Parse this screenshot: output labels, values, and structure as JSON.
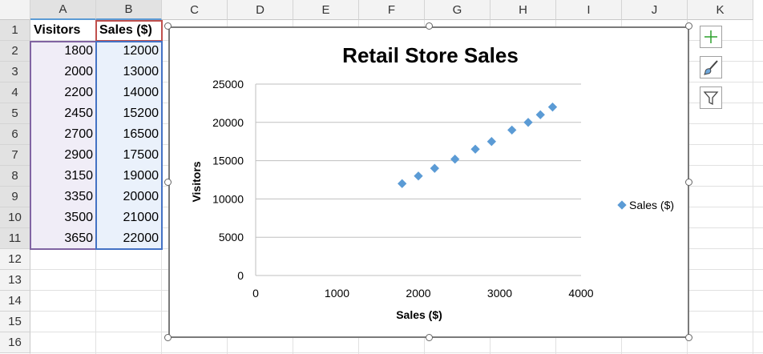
{
  "spreadsheet": {
    "columns": [
      "A",
      "B",
      "C",
      "D",
      "E",
      "F",
      "G",
      "H",
      "I",
      "J",
      "K"
    ],
    "rows": [
      "1",
      "2",
      "3",
      "4",
      "5",
      "6",
      "7",
      "8",
      "9",
      "10",
      "11",
      "12",
      "13",
      "14",
      "15",
      "16"
    ],
    "header": [
      "Visitors",
      "Sales ($)"
    ],
    "data": [
      [
        "1800",
        "12000"
      ],
      [
        "2000",
        "13000"
      ],
      [
        "2200",
        "14000"
      ],
      [
        "2450",
        "15200"
      ],
      [
        "2700",
        "16500"
      ],
      [
        "2900",
        "17500"
      ],
      [
        "3150",
        "19000"
      ],
      [
        "3350",
        "20000"
      ],
      [
        "3500",
        "21000"
      ],
      [
        "3650",
        "22000"
      ]
    ]
  },
  "colors": {
    "marker": "#5b9bd5",
    "range_blue": "#4472c4",
    "range_purple": "#8064a2",
    "range_red": "#c0504d",
    "chart_element_plus": "#2ca02c"
  },
  "side_buttons": [
    "plus-icon",
    "brush-icon",
    "filter-icon"
  ],
  "chart_data": {
    "type": "scatter",
    "title": "Retail Store Sales",
    "xlabel": "Sales ($)",
    "ylabel": "Visitors",
    "xlim": [
      0,
      4000
    ],
    "ylim": [
      0,
      25000
    ],
    "xticks": [
      "0",
      "1000",
      "2000",
      "3000",
      "4000"
    ],
    "yticks": [
      "0",
      "5000",
      "10000",
      "15000",
      "20000",
      "25000"
    ],
    "grid": "horizontal",
    "legend": "right",
    "series": [
      {
        "name": "Sales ($)",
        "x": [
          1800,
          2000,
          2200,
          2450,
          2700,
          2900,
          3150,
          3350,
          3500,
          3650
        ],
        "y": [
          12000,
          13000,
          14000,
          15200,
          16500,
          17500,
          19000,
          20000,
          21000,
          22000
        ]
      }
    ]
  }
}
